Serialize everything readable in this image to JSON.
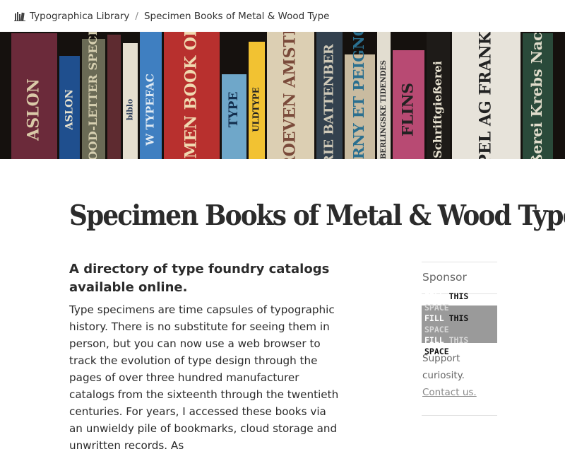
{
  "breadcrumb": {
    "home_icon": "library-icon",
    "home_label": "Typographica Library",
    "separator": "/",
    "current_label": "Specimen Books of Metal & Wood Type"
  },
  "hero": {
    "spines": [
      {
        "text": "ASLON",
        "color": "#6b2a3a",
        "text_color": "#d9c9a8"
      },
      {
        "text": "ASLON",
        "color": "#1f4f8e",
        "text_color": "#e8e2cf"
      },
      {
        "text": "& SONS' WOOD-LETTER SPECIMENS.",
        "color": "#6a6a55",
        "text_color": "#d6cfb0"
      },
      {
        "text": "",
        "color": "#5e2b30",
        "text_color": "#cfc1a2"
      },
      {
        "text": "biblo",
        "color": "#e6dfcf",
        "text_color": "#2d3d5a"
      },
      {
        "text": "W TYPEFAC",
        "color": "#3f7fc1",
        "text_color": "#dfe9f2"
      },
      {
        "text": "AMERICAN SPECIMEN BOOK OF TYPE STYLES",
        "color": "#b8302e",
        "text_color": "#f0d9b0"
      },
      {
        "text": "TYPE",
        "color": "#6fa7c9",
        "text_color": "#143050"
      },
      {
        "text": "ULDTYPE",
        "color": "#f2c232",
        "text_color": "#222222"
      },
      {
        "text": "LETTERPROEVEN AMSTERDAM",
        "color": "#dccfb3",
        "text_color": "#7a4a3a"
      },
      {
        "text": "ERIE BATTENBER",
        "color": "#33414e",
        "text_color": "#cfc9b8"
      },
      {
        "text": "DEBERNY ET PEIGNOT",
        "color": "#c9bba0",
        "text_color": "#2a6f8f"
      },
      {
        "text": "BERLINGSKE TIDENDES",
        "color": "#e2ddd0",
        "text_color": "#333333"
      },
      {
        "text": "FLINS",
        "color": "#b84a73",
        "text_color": "#222222"
      },
      {
        "text": "Schriftgießerei",
        "color": "#1e1b18",
        "text_color": "#e8e2d0"
      },
      {
        "text": "D·STEMPEL AG FRANKFURT",
        "color": "#e7e3da",
        "text_color": "#222222"
      },
      {
        "text": "Schriftgießerei Krebs Nachfolger",
        "color": "#2a4a3a",
        "text_color": "#e0dccb"
      }
    ]
  },
  "page": {
    "title": "Specimen Books of Metal & Wood Type",
    "subhead": "A directory of type foundry catalogs available online.",
    "body": "Type specimens are time capsules of typographic history. There is no substitute for seeing them in person, but you can now use a web browser to track the evolution of type design through the pages of over three hundred manufacturer catalogs from the sixteenth through the twentieth centuries. For years, I accessed these books via an unwieldy pile of bookmarks, cloud storage and unwritten records. As"
  },
  "sidebar": {
    "title": "Sponsor",
    "ad_lines": [
      [
        "FILL",
        " THIS ",
        "SPACE"
      ],
      [
        "FILL",
        " THIS ",
        "SPACE"
      ],
      [
        "FILL",
        " THIS ",
        "SPACE"
      ]
    ],
    "support_text": "Support curiosity.",
    "contact_label": "Contact us."
  }
}
